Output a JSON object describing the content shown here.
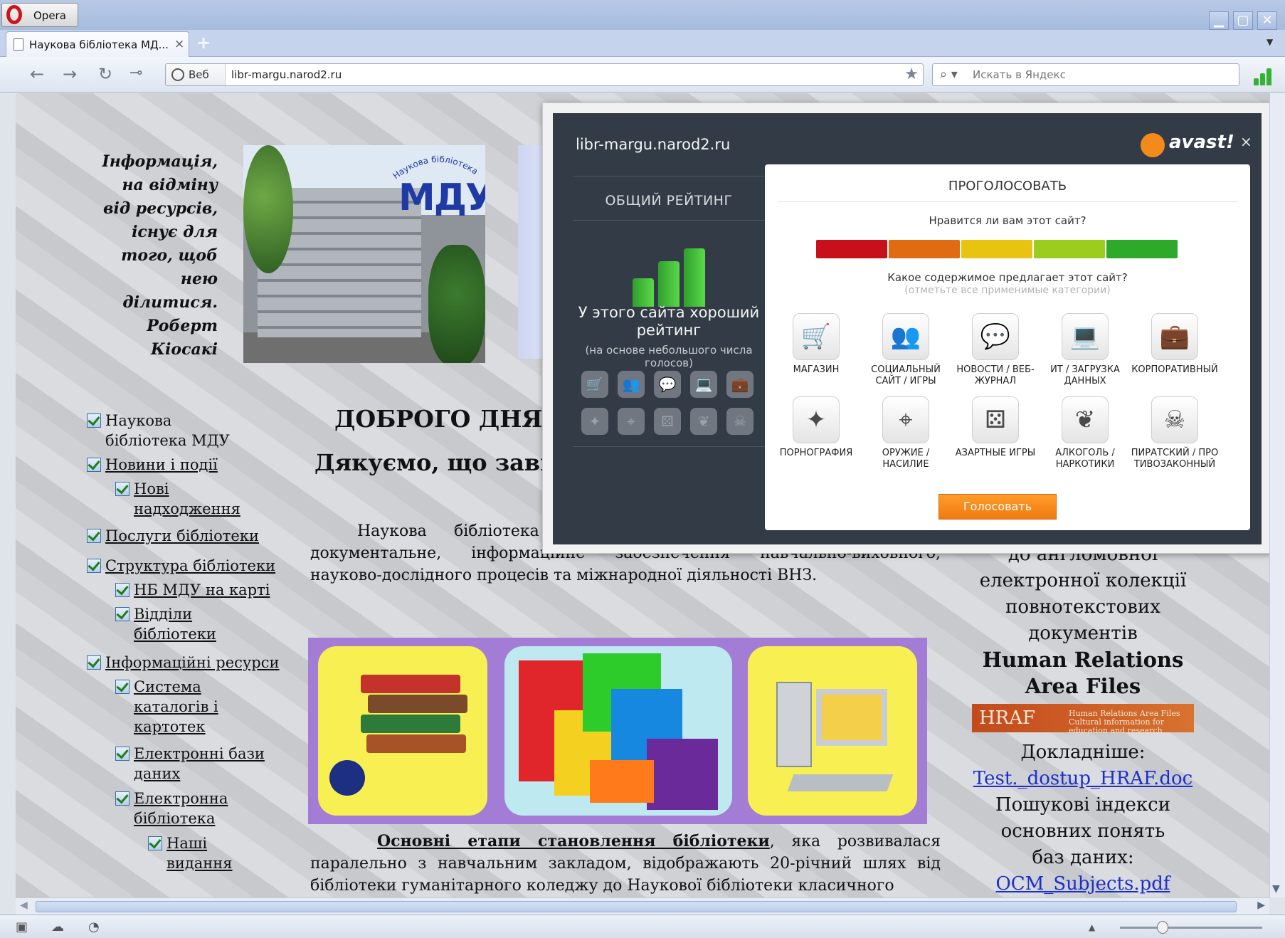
{
  "browser": {
    "menu_label": "Opera",
    "tab_title": "Наукова бібліотека МД...",
    "tab_close": "×",
    "new_tab": "+",
    "address_badge": "Веб",
    "address_url": "libr-margu.narod2.ru",
    "search_placeholder": "Искать в Яндекс",
    "icons": [
      "back-icon",
      "forward-icon",
      "reload-icon",
      "key-icon",
      "globe-icon",
      "star-icon",
      "search-icon",
      "avast-rating-icon"
    ]
  },
  "page": {
    "quote": [
      "Інформація,",
      "на відміну",
      "від ресурсів,",
      "існує для",
      "того, щоб",
      "нею",
      "ділитися.",
      "Роберт",
      "Кіосакі"
    ],
    "photo_logo_text": "МДУ",
    "photo_logo_arc": "Наукова бібліотека",
    "nav": [
      {
        "label": "Наукова бібліотека МДУ",
        "link": false
      },
      {
        "label": "Новини і події",
        "link": true
      },
      {
        "label": "Нові надходження",
        "link": true
      },
      {
        "label": "Послуги бібліотеки",
        "link": true
      },
      {
        "label": "Структура бібліотеки",
        "link": true
      },
      {
        "label": "НБ МДУ на карті",
        "link": true
      },
      {
        "label": "Відділи бібліотеки",
        "link": true
      },
      {
        "label": "Інформаційні ресурси",
        "link": true
      },
      {
        "label": "Система каталогів і картотек",
        "link": true
      },
      {
        "label": "Електронні бази даних",
        "link": true
      },
      {
        "label": "Електронна бібліотека",
        "link": true
      },
      {
        "label": "Наші видання",
        "link": true
      }
    ],
    "heading": "ДОБРОГО ДНЯ",
    "subheading": "Дякуємо, що завіт",
    "intro": "Наукова бібліотека М діяльність якого спрямована на документальне, інформаційне забезпечення навчально-виховного, науково-дослідного процесів та міжнародної діяльності ВНЗ.",
    "history_link": "Основні етапи становлення бібліотеки",
    "history_text": ", яка розвивалася паралельно з навчальним закладом, відображають 20-річний шлях від бібліотеки гуманітарного коледжу до Наукової бібліотеки класичного",
    "right": {
      "line1": "до англомовної",
      "line2": "електронної колекції",
      "line3": "повнотекстових",
      "line4": "документів",
      "bold1": "Human Relations",
      "bold2": "Area Files",
      "hraf_logo": "HRAF",
      "hraf_sub1": "Human Relations Area Files",
      "hraf_sub2": "Cultural information for education and research",
      "more": "Докладніше:",
      "link1": "Test._dostup_HRAF.doc",
      "search_idx1": "Пошукові індекси",
      "search_idx2": "основних понять",
      "search_idx3": "баз даних:",
      "link2": "OCM_Subjects.pdf"
    }
  },
  "avast": {
    "domain": "libr-margu.narod2.ru",
    "brand": "avast!",
    "close": "×",
    "overall_title": "ОБЩИЙ РЕЙТИНГ",
    "rating_text": "У этого сайта хороший рейтинг",
    "rating_note": "(на основе небольшого числа голосов)",
    "vote_title": "ПРОГОЛОСОВАТЬ",
    "question_like": "Нравится ли вам этот сайт?",
    "scale_colors": [
      "#c8101a",
      "#e06b10",
      "#e8c310",
      "#9ccc1e",
      "#2daa2a"
    ],
    "question_content": "Какое содержимое предлагает этот сайт?",
    "question_note": "(отметьте все применимые категории)",
    "categories": [
      {
        "label": "МАГАЗИН",
        "icon": "cart-icon",
        "glyph": "🛒"
      },
      {
        "label": "СОЦИАЛЬНЫЙ САЙТ / ИГРЫ",
        "icon": "people-icon",
        "glyph": "👥"
      },
      {
        "label": "НОВОСТИ / ВЕБ-ЖУРНАЛ",
        "icon": "speech-bubble-icon",
        "glyph": "💬"
      },
      {
        "label": "ИТ / ЗАГРУЗКА ДАННЫХ",
        "icon": "laptop-icon",
        "glyph": "💻"
      },
      {
        "label": "КОРПОРАТИВНЫЙ",
        "icon": "briefcase-icon",
        "glyph": "💼"
      },
      {
        "label": "ПОРНОГРАФИЯ",
        "icon": "star4-icon",
        "glyph": "✦"
      },
      {
        "label": "ОРУЖИЕ / НАСИЛИЕ",
        "icon": "crosshair-icon",
        "glyph": "⌖"
      },
      {
        "label": "АЗАРТНЫЕ ИГРЫ",
        "icon": "dice-icon",
        "glyph": "⚄"
      },
      {
        "label": "АЛКОГОЛЬ / НАРКОТИКИ",
        "icon": "leaf-icon",
        "glyph": "❦"
      },
      {
        "label": "ПИРАТСКИЙ / ПРОТИВОЗАКОННЫЙ",
        "icon": "skull-icon",
        "glyph": "☠"
      }
    ],
    "vote_button": "Голосовать"
  }
}
